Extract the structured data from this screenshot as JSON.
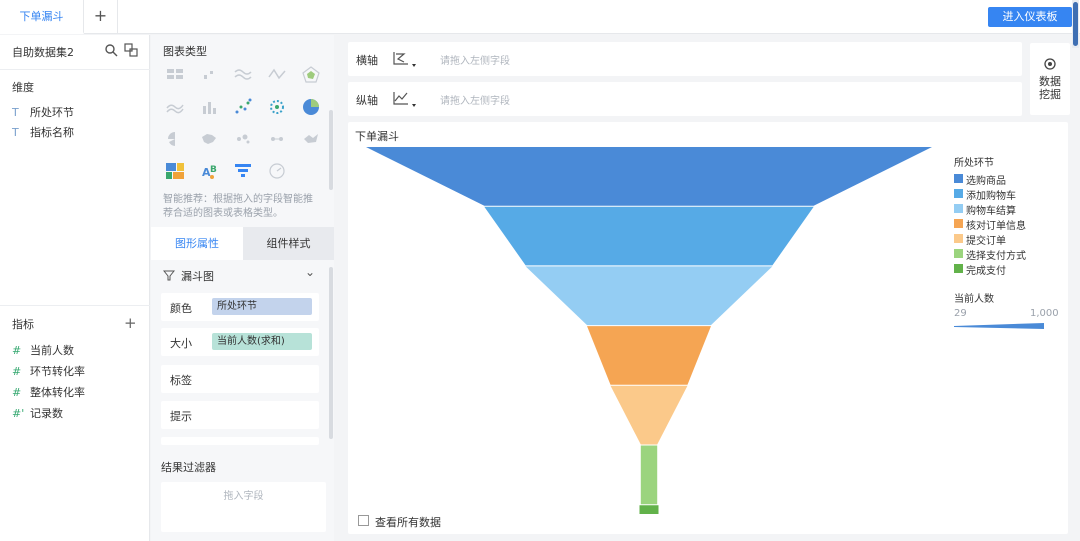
{
  "top": {
    "tab_label": "下单漏斗",
    "add_tab": "+",
    "enter_dashboard": "进入仪表板"
  },
  "left": {
    "dataset": "自助数据集2",
    "dimensions_title": "维度",
    "dimensions": [
      {
        "type": "T",
        "name": "所处环节"
      },
      {
        "type": "T",
        "name": "指标名称"
      }
    ],
    "metrics_title": "指标",
    "metrics": [
      {
        "type": "#",
        "name": "当前人数"
      },
      {
        "type": "#",
        "name": "环节转化率"
      },
      {
        "type": "#",
        "name": "整体转化率"
      },
      {
        "type": "#'",
        "name": "记录数"
      }
    ]
  },
  "middle": {
    "chart_types_title": "图表类型",
    "hint": "智能推荐：根据拖入的字段智能推荐合适的图表或表格类型。",
    "tabs": [
      "图形属性",
      "组件样式"
    ],
    "chart_type_select": "漏斗图",
    "properties": [
      {
        "key": "颜色",
        "value": "所处环节",
        "style": "blue"
      },
      {
        "key": "大小",
        "value": "当前人数(求和)",
        "style": "green"
      },
      {
        "key": "标签",
        "value": ""
      },
      {
        "key": "提示",
        "value": ""
      }
    ],
    "result_filter_title": "结果过滤器",
    "result_filter_placeholder": "拖入字段"
  },
  "axes": {
    "x_label": "横轴",
    "x_placeholder": "请拖入左侧字段",
    "y_label": "纵轴",
    "y_placeholder": "请拖入左侧字段",
    "mining_label_1": "数据",
    "mining_label_2": "挖掘"
  },
  "chart": {
    "view_all_label": "查看所有数据",
    "legend_title": "所处环节",
    "size_legend_title": "当前人数",
    "size_min": "29",
    "size_max": "1,000",
    "colors": [
      "#4a8ad7",
      "#56aae6",
      "#94cdf3",
      "#f5a553",
      "#fbc98a",
      "#9bd47e",
      "#62b24a"
    ]
  },
  "chart_data": {
    "type": "funnel",
    "title": "下单漏斗",
    "categories": [
      "选购商品",
      "添加购物车",
      "购物车结算",
      "核对订单信息",
      "提交订单",
      "选择支付方式",
      "完成支付"
    ],
    "values": [
      1000,
      582,
      436,
      219,
      136,
      29,
      null
    ],
    "size_range": [
      29,
      1000
    ],
    "legend_position": "right"
  }
}
